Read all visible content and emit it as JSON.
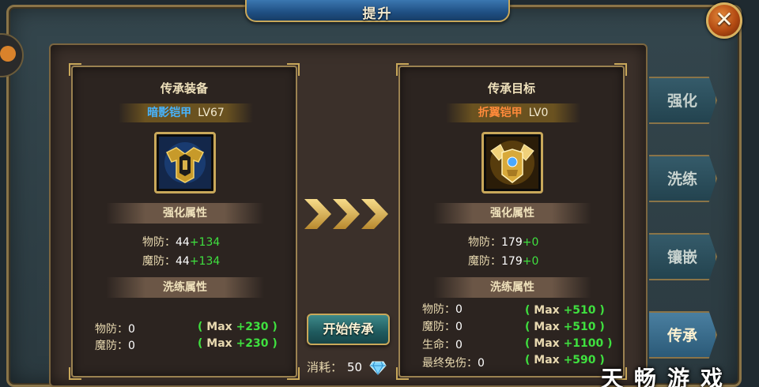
{
  "window": {
    "title": "提升",
    "close_glyph": "✕"
  },
  "left_panel": {
    "title": "传承装备",
    "equip_name": "暗影铠甲",
    "level": "LV67",
    "icon": "dark-armor-icon",
    "strength_section": "强化属性",
    "strength_stats": [
      {
        "label": "物防：",
        "base": "44",
        "bonus": "+134"
      },
      {
        "label": "魔防：",
        "base": "44",
        "bonus": "+134"
      }
    ],
    "refine_section": "洗练属性",
    "refine_stats": [
      {
        "label": "物防：",
        "value": "0",
        "max_open": "( ",
        "max_label": "Max",
        "max_value": "+230",
        "max_close": " )"
      },
      {
        "label": "魔防：",
        "value": "0",
        "max_open": "( ",
        "max_label": "Max",
        "max_value": "+230",
        "max_close": " )"
      }
    ]
  },
  "right_panel": {
    "title": "传承目标",
    "equip_name": "折翼铠甲",
    "level": "LV0",
    "icon": "golden-winged-armor-icon",
    "strength_section": "强化属性",
    "strength_stats": [
      {
        "label": "物防：",
        "base": "179",
        "bonus": "+0"
      },
      {
        "label": "魔防：",
        "base": "179",
        "bonus": "+0"
      }
    ],
    "refine_section": "洗练属性",
    "refine_stats": [
      {
        "label": "物防：",
        "value": "0",
        "max_open": "( ",
        "max_label": "Max",
        "max_value": "+510",
        "max_close": " )"
      },
      {
        "label": "魔防：",
        "value": "0",
        "max_open": "( ",
        "max_label": "Max",
        "max_value": "+510",
        "max_close": " )"
      },
      {
        "label": "生命：",
        "value": "0",
        "max_open": "( ",
        "max_label": "Max",
        "max_value": "+1100",
        "max_close": " )"
      },
      {
        "label": "最终免伤：",
        "value": "0",
        "max_open": "( ",
        "max_label": "Max",
        "max_value": "+590",
        "max_close": " )"
      }
    ]
  },
  "action": {
    "start_label": "开始传承",
    "cost_label": "消耗：",
    "cost_value": "50",
    "cost_icon": "diamond-icon"
  },
  "tabs": [
    {
      "label": "强化",
      "active": false
    },
    {
      "label": "洗练",
      "active": false
    },
    {
      "label": "镶嵌",
      "active": false
    },
    {
      "label": "传承",
      "active": true
    }
  ],
  "watermark": "天畅游戏",
  "colors": {
    "gold_border": "#c9a85a",
    "green_bonus": "#3fe03f",
    "left_name": "#47b4ff",
    "right_name": "#ff8a3a"
  }
}
